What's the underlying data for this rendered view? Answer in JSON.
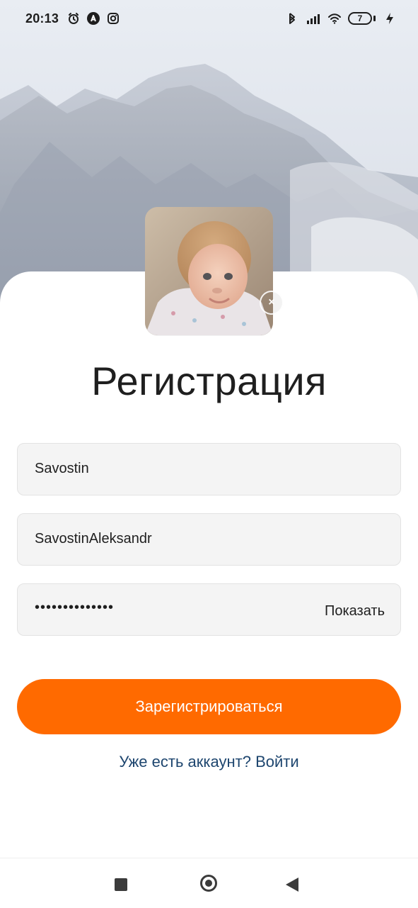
{
  "status_bar": {
    "time": "20:13",
    "left_icons": [
      "alarm-icon",
      "a-circle-icon",
      "instagram-icon"
    ],
    "right_icons": [
      "bluetooth-icon",
      "signal-icon",
      "wifi-icon",
      "battery-icon",
      "charging-icon"
    ],
    "battery_level": "7"
  },
  "registration": {
    "title": "Регистрация",
    "avatar_remove_icon": "close-icon",
    "fields": {
      "lastname_value": "Savostin",
      "login_value": "SavostinAleksandr",
      "password_masked": "••••••••••••••",
      "password_toggle_label": "Показать"
    },
    "submit_label": "Зарегистрироваться",
    "login_link_label": "Уже есть аккаунт? Войти"
  },
  "colors": {
    "accent": "#ff6a00",
    "link": "#1e466f"
  },
  "navigation": {
    "recents_icon": "recents-square-icon",
    "home_icon": "home-circle-icon",
    "back_icon": "back-triangle-icon"
  }
}
